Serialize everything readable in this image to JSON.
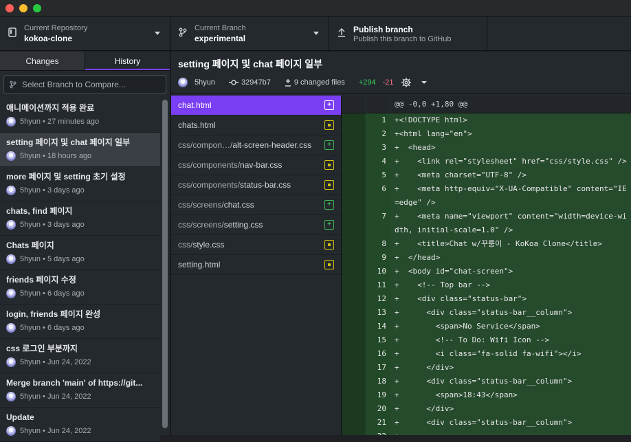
{
  "toolbar": {
    "repo_small": "Current Repository",
    "repo_name": "kokoa-clone",
    "branch_small": "Current Branch",
    "branch_name": "experimental",
    "publish_title": "Publish branch",
    "publish_sub": "Publish this branch to GitHub"
  },
  "sidebar": {
    "tabs": [
      "Changes",
      "History"
    ],
    "compare_placeholder": "Select Branch to Compare...",
    "commits": [
      {
        "title": "애니메이션까지 적용 완료",
        "author": "5hyun",
        "time": "27 minutes ago"
      },
      {
        "title": "setting 페이지 및 chat 페이지 일부",
        "author": "5hyun",
        "time": "18 hours ago"
      },
      {
        "title": "more 페이지 및 setting 초기 설정",
        "author": "5hyun",
        "time": "3 days ago"
      },
      {
        "title": "chats, find 페이지",
        "author": "5hyun",
        "time": "3 days ago"
      },
      {
        "title": "Chats 페이지",
        "author": "5hyun",
        "time": "5 days ago"
      },
      {
        "title": "friends 페이지 수정",
        "author": "5hyun",
        "time": "6 days ago"
      },
      {
        "title": "login, friends 페이지 완성",
        "author": "5hyun",
        "time": "6 days ago"
      },
      {
        "title": "css 로그인 부분까지",
        "author": "5hyun",
        "time": "Jun 24, 2022"
      },
      {
        "title": "Merge branch 'main' of https://git...",
        "author": "5hyun",
        "time": "Jun 24, 2022"
      },
      {
        "title": "Update",
        "author": "5hyun",
        "time": "Jun 24, 2022"
      }
    ]
  },
  "main": {
    "title": "setting 페이지 및 chat 페이지 일부",
    "author": "5hyun",
    "sha": "32947b7",
    "changed_files": "9 changed files",
    "additions": "+294",
    "deletions": "-21",
    "files": [
      {
        "dir": "",
        "name": "chat.html",
        "status": "new"
      },
      {
        "dir": "",
        "name": "chats.html",
        "status": "mod"
      },
      {
        "dir": "css/compon…/",
        "name": "alt-screen-header.css",
        "status": "new"
      },
      {
        "dir": "css/components/",
        "name": "nav-bar.css",
        "status": "mod"
      },
      {
        "dir": "css/components/",
        "name": "status-bar.css",
        "status": "mod"
      },
      {
        "dir": "css/screens/",
        "name": "chat.css",
        "status": "new"
      },
      {
        "dir": "css/screens/",
        "name": "setting.css",
        "status": "new"
      },
      {
        "dir": "css/",
        "name": "style.css",
        "status": "mod"
      },
      {
        "dir": "",
        "name": "setting.html",
        "status": "mod"
      }
    ],
    "hunk_header": "@@ -0,0 +1,80 @@",
    "diff_lines": [
      {
        "n": "1",
        "t": "+<!DOCTYPE html>"
      },
      {
        "n": "2",
        "t": "+<html lang=\"en\">"
      },
      {
        "n": "3",
        "t": "+  <head>"
      },
      {
        "n": "4",
        "t": "+    <link rel=\"stylesheet\" href=\"css/style.css\" />"
      },
      {
        "n": "5",
        "t": "+    <meta charset=\"UTF-8\" />"
      },
      {
        "n": "6",
        "t": "+    <meta http-equiv=\"X-UA-Compatible\" content=\"IE=edge\" />"
      },
      {
        "n": "7",
        "t": "+    <meta name=\"viewport\" content=\"width=device-width, initial-scale=1.0\" />"
      },
      {
        "n": "8",
        "t": "+    <title>Chat w/꾸룽이 - KoKoa Clone</title>"
      },
      {
        "n": "9",
        "t": "+  </head>"
      },
      {
        "n": "10",
        "t": "+  <body id=\"chat-screen\">"
      },
      {
        "n": "11",
        "t": "+    <!-- Top bar -->"
      },
      {
        "n": "12",
        "t": "+    <div class=\"status-bar\">"
      },
      {
        "n": "13",
        "t": "+      <div class=\"status-bar__column\">"
      },
      {
        "n": "14",
        "t": "+        <span>No Service</span>"
      },
      {
        "n": "15",
        "t": "+        <!-- To Do: Wifi Icon -->"
      },
      {
        "n": "16",
        "t": "+        <i class=\"fa-solid fa-wifi\"></i>"
      },
      {
        "n": "17",
        "t": "+      </div>"
      },
      {
        "n": "18",
        "t": "+      <div class=\"status-bar__column\">"
      },
      {
        "n": "19",
        "t": "+        <span>18:43</span>"
      },
      {
        "n": "20",
        "t": "+      </div>"
      },
      {
        "n": "21",
        "t": "+      <div class=\"status-bar__column\">"
      },
      {
        "n": "22",
        "t": "+"
      }
    ]
  },
  "colors": {
    "accent": "#7a3ff2",
    "added": "#34d058",
    "deleted": "#f97583"
  }
}
